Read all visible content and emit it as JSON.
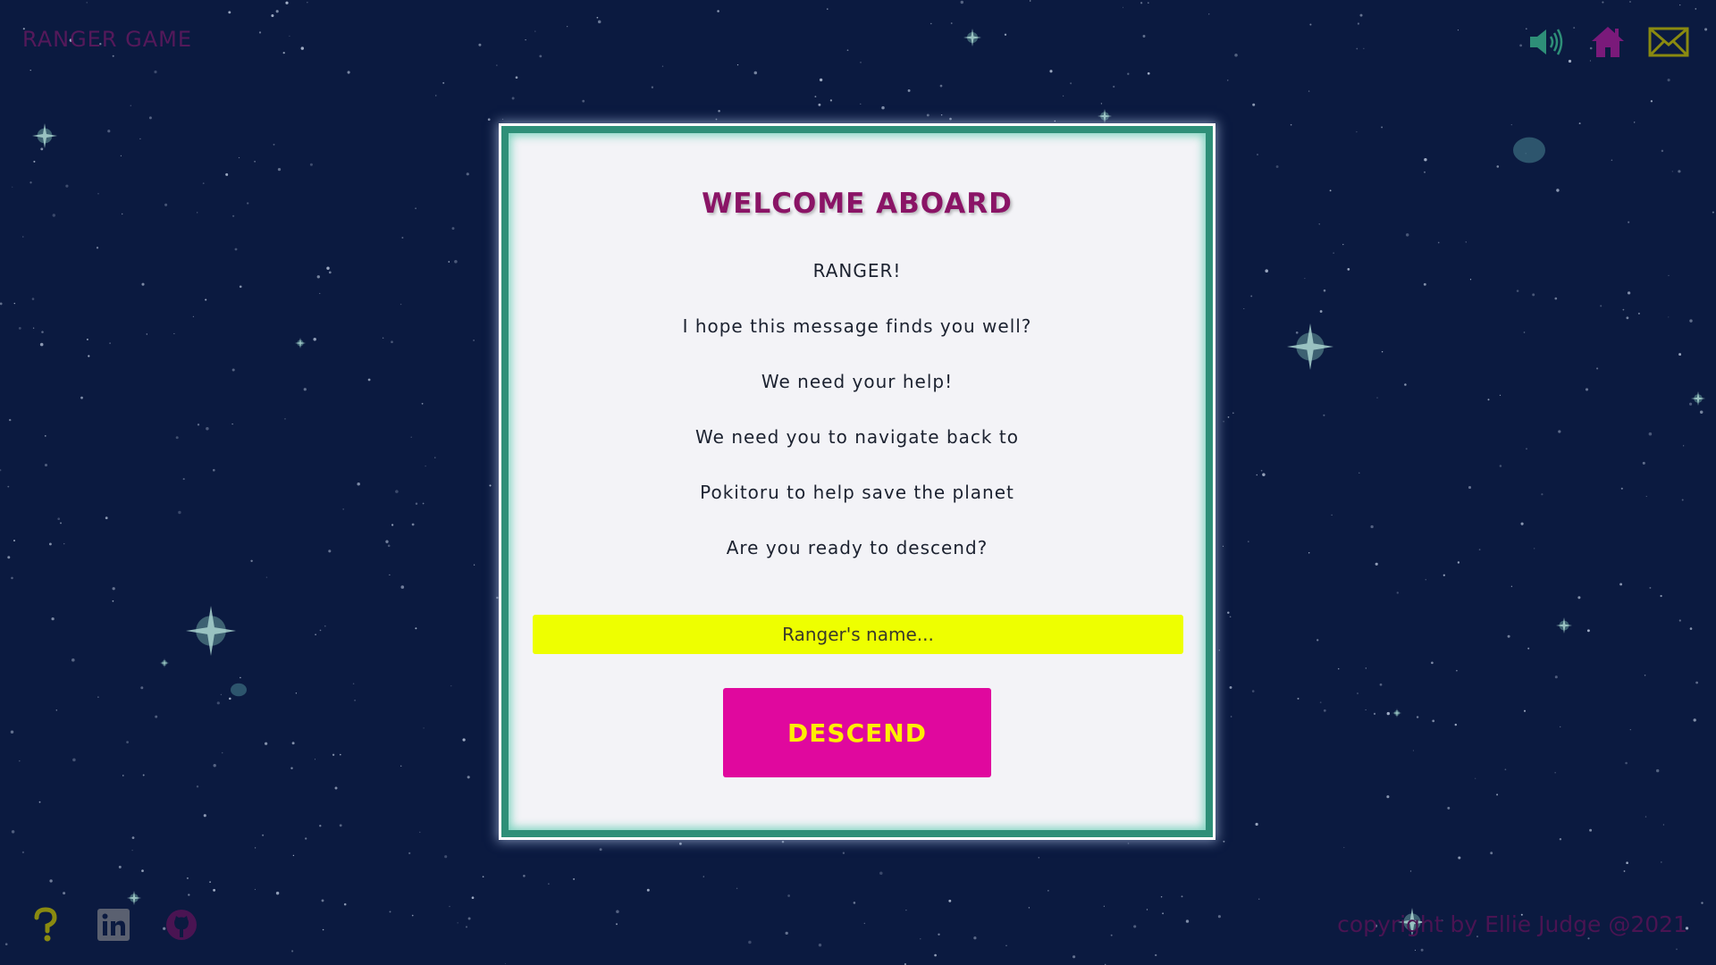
{
  "brand": {
    "title": "RANGER GAME"
  },
  "header": {
    "icons": [
      "speaker-icon",
      "home-icon",
      "envelope-icon"
    ],
    "colors": {
      "speaker": "#2e8f78",
      "home": "#7a1a7a",
      "envelope": "#8a8a10"
    }
  },
  "modal": {
    "title": "WELCOME ABOARD",
    "lines": [
      "RANGER!",
      "I hope this message finds you well?",
      "We need your help!",
      "We need you to navigate back to",
      "Pokitoru to help save the planet",
      "Are you ready to descend?"
    ],
    "name_placeholder": "Ranger's name...",
    "name_value": "",
    "descend_label": "DESCEND"
  },
  "footer": {
    "icons": [
      "question-icon",
      "linkedin-icon",
      "github-icon"
    ],
    "copyright": "copyright by Ellie Judge @2021"
  },
  "colors": {
    "background": "#0b1a40",
    "modal_bg": "#f3f3f7",
    "modal_border": "#2e8f78",
    "title": "#8a1466",
    "input_bg": "#eeff00",
    "button_bg": "#e0089e",
    "button_text": "#ffee00"
  }
}
